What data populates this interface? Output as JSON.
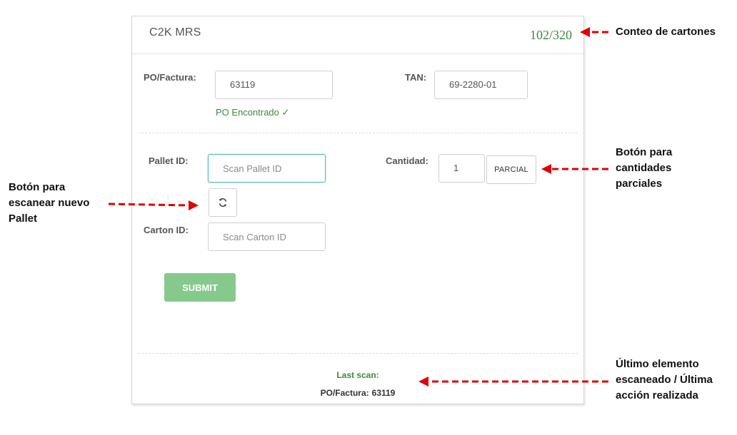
{
  "header": {
    "title": "C2K MRS",
    "carton_count": "102/320"
  },
  "po": {
    "label": "PO/Factura:",
    "value": "63119",
    "status": "PO Encontrado ✓"
  },
  "tan": {
    "label": "TAN:",
    "value": "69-2280-01"
  },
  "pallet": {
    "label": "Pallet ID:",
    "placeholder": "Scan Pallet ID"
  },
  "carton": {
    "label": "Carton ID:",
    "placeholder": "Scan Carton ID"
  },
  "cantidad": {
    "label": "Cantidad:",
    "value": "1",
    "button_label": "PARCIAL"
  },
  "submit": {
    "label": "SUBMIT"
  },
  "last_scan": {
    "label": "Last scan:",
    "key": "PO/Factura:",
    "value": "63119"
  },
  "annotations": {
    "count": "Conteo de cartones",
    "parcial_lines": [
      "Botón para",
      "cantidades",
      "parciales"
    ],
    "new_pallet_lines": [
      "Botón para",
      "escanear nuevo",
      "Pallet"
    ],
    "last_lines": [
      "Último elemento",
      "escaneado / Última",
      "acción realizada"
    ]
  },
  "colors": {
    "accent_green": "#3c8a3c",
    "submit_green": "#86c98c",
    "focus_teal": "#4fb7bf",
    "arrow_red": "#e00000"
  },
  "icons": {
    "refresh": "refresh-icon"
  }
}
